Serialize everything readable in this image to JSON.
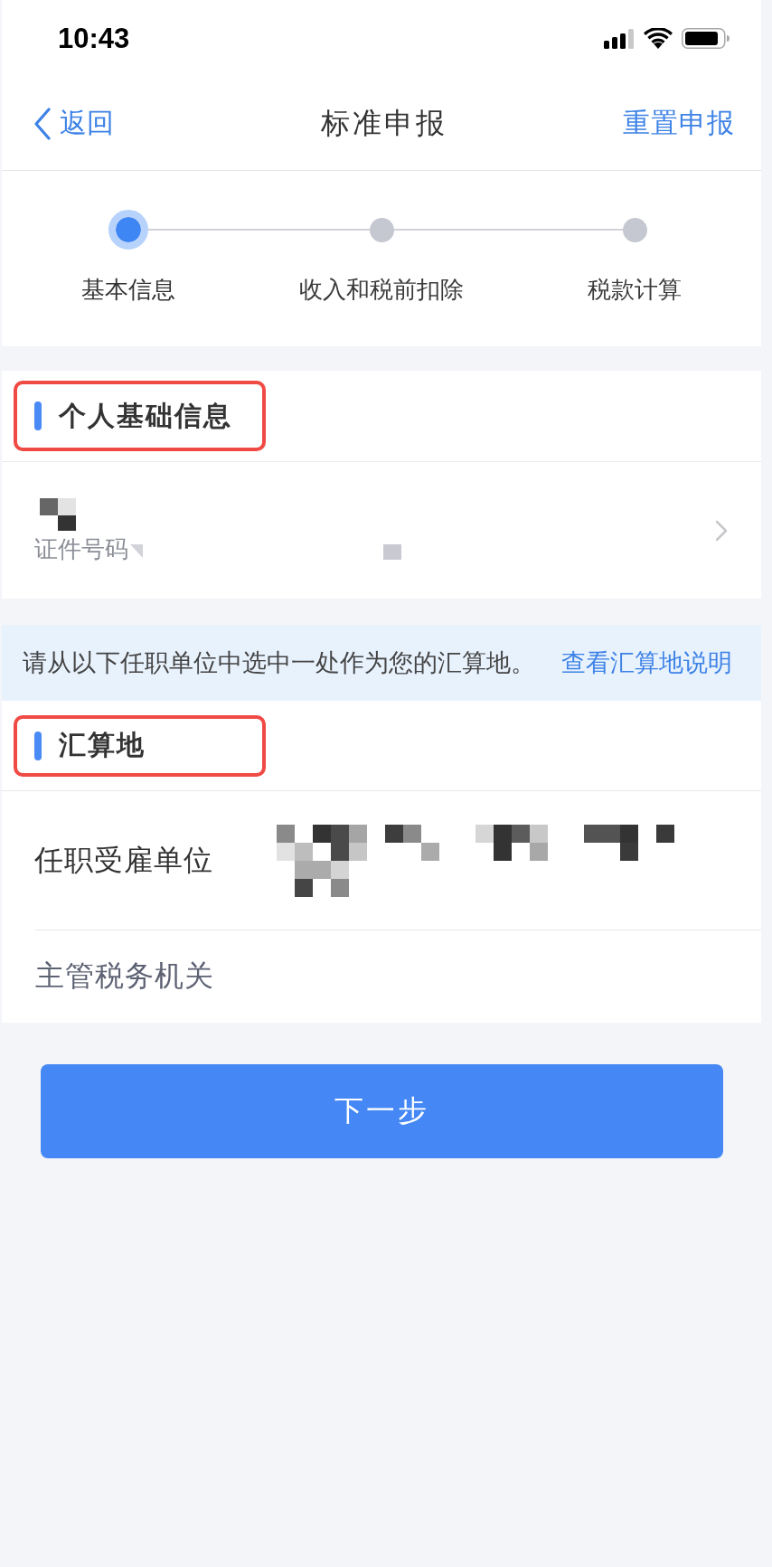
{
  "status_bar": {
    "time": "10:43"
  },
  "nav_bar": {
    "back_label": "返回",
    "title": "标准申报",
    "action": "重置申报"
  },
  "stepper": {
    "steps": [
      {
        "label": "基本信息",
        "selected": true
      },
      {
        "label": "收入和税前扣除",
        "selected": false
      },
      {
        "label": "税款计算",
        "selected": false
      }
    ]
  },
  "personal_info": {
    "title": "个人基础信息",
    "highlighted": true,
    "id_label": "证件号码"
  },
  "notice": {
    "text": "请从以下任职单位中选中一处作为您的汇算地。",
    "link": "查看汇算地说明"
  },
  "settlement": {
    "title": "汇算地",
    "highlighted": true,
    "rows": [
      {
        "label": "任职受雇单位",
        "kind": "redacted",
        "disabled": false
      },
      {
        "label": "主管税务机关",
        "kind": "empty",
        "disabled": true
      }
    ]
  },
  "next_button": {
    "label": "下一步"
  }
}
